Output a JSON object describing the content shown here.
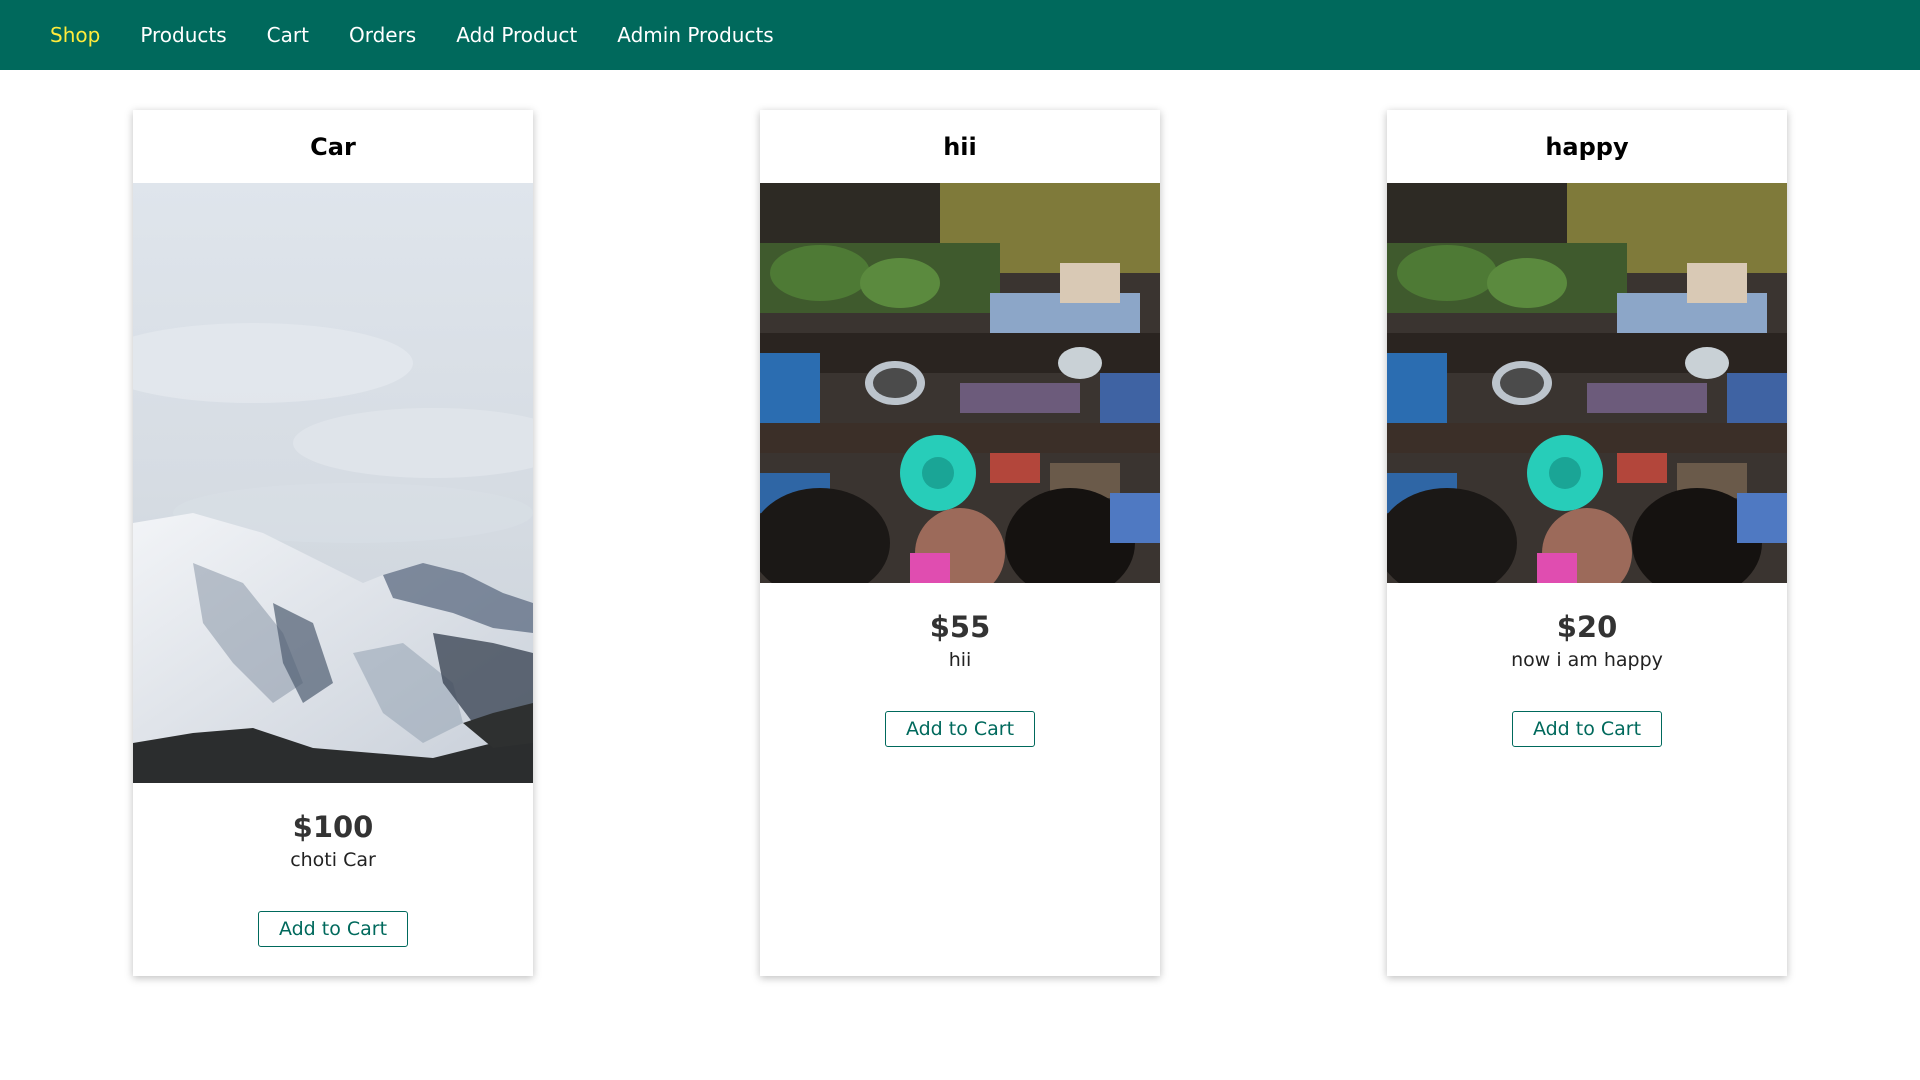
{
  "nav": {
    "items": [
      {
        "label": "Shop",
        "active": true
      },
      {
        "label": "Products",
        "active": false
      },
      {
        "label": "Cart",
        "active": false
      },
      {
        "label": "Orders",
        "active": false
      },
      {
        "label": "Add Product",
        "active": false
      },
      {
        "label": "Admin Products",
        "active": false
      }
    ]
  },
  "products": [
    {
      "title": "Car",
      "price": "$100",
      "description": "choti Car",
      "image": "snowy-mountain-photo",
      "button_label": "Add to Cart"
    },
    {
      "title": "hii",
      "price": "$55",
      "description": "hii",
      "image": "floating-market-photo",
      "button_label": "Add to Cart"
    },
    {
      "title": "happy",
      "price": "$20",
      "description": "now i am happy",
      "image": "floating-market-photo",
      "button_label": "Add to Cart"
    }
  ],
  "colors": {
    "header_bg": "#00695c",
    "nav_active": "#ffeb3b",
    "nav_text": "#ffffff",
    "button_accent": "#00695c"
  }
}
